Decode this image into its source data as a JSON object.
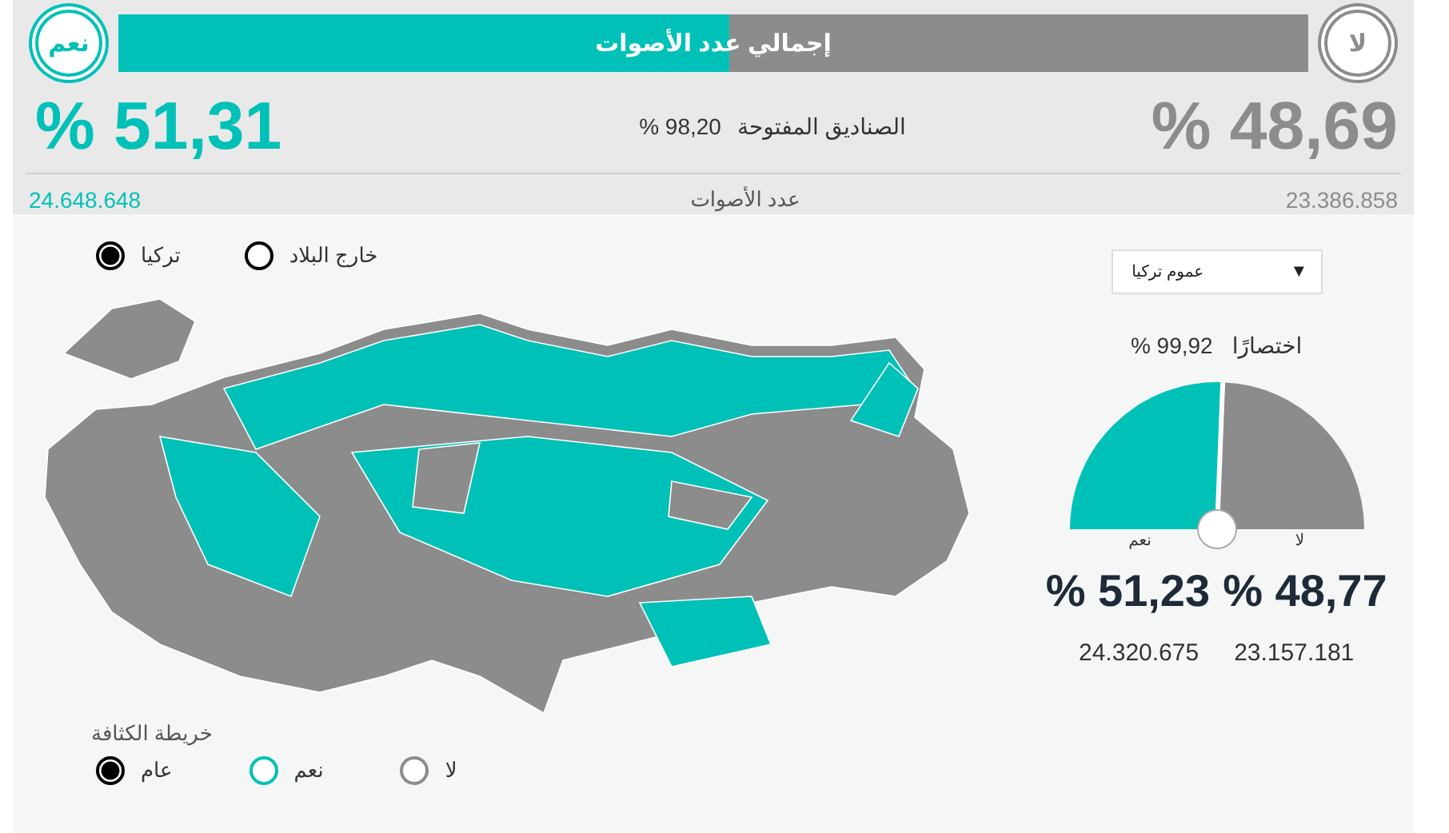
{
  "header": {
    "yes_badge": "نعم",
    "no_badge": "لا",
    "title": "إجمالي عدد الأصوات",
    "level": 0.5131,
    "yes_percent": "% 51,31",
    "no_percent": "% 48,69",
    "open_boxes_label": "الصناديق المفتوحة",
    "open_boxes_value": "% 98,20",
    "votes_label": "عدد الأصوات",
    "yes_votes": "24.648.648",
    "no_votes": "23.386.858"
  },
  "region_options": [
    {
      "label": "خارج البلاد",
      "selected": false
    },
    {
      "label": "تركيا",
      "selected": true
    }
  ],
  "summary": {
    "dropdown": "عموم تركيا",
    "dropdown_arrow": "▼",
    "counted_label": "اختصارًا",
    "counted_value": "% 99,92",
    "level": 0.5123,
    "yes_label": "نعم",
    "no_label": "لا",
    "yes_percent": "% 51,23",
    "no_percent": "% 48,77",
    "yes_votes": "24.320.675",
    "no_votes": "23.157.181"
  },
  "density": {
    "title": "خريطة الكثافة",
    "options": [
      {
        "label": "لا",
        "selected": false,
        "color": "#8c8c8c"
      },
      {
        "label": "نعم",
        "selected": false,
        "color": "#00c1b7"
      },
      {
        "label": "عام",
        "selected": true,
        "color": "#000000"
      }
    ]
  }
}
